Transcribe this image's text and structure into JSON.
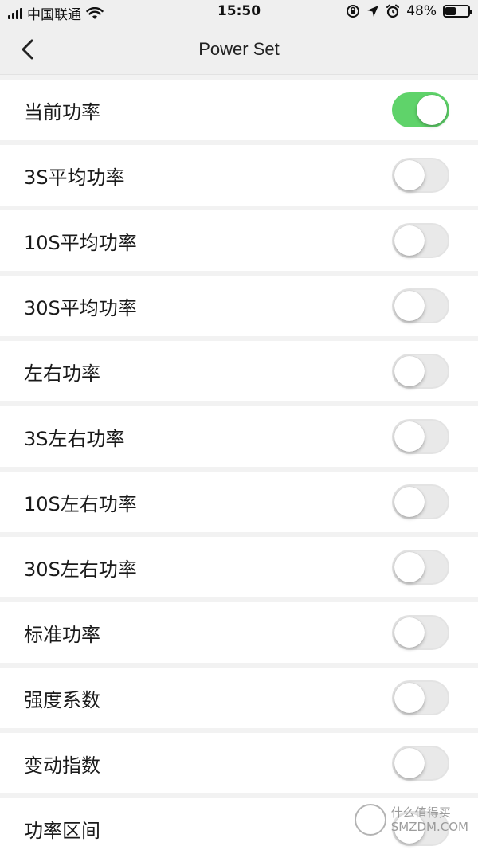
{
  "status_bar": {
    "carrier": "中国联通",
    "time": "15:50",
    "battery_percent_text": "48%",
    "battery_level": 0.48
  },
  "nav": {
    "title": "Power Set"
  },
  "colors": {
    "toggle_on": "#5fd36a",
    "toggle_off": "#e9e9e9",
    "background": "#f2f2f2"
  },
  "settings": [
    {
      "label": "当前功率",
      "enabled": true
    },
    {
      "label": "3S平均功率",
      "enabled": false
    },
    {
      "label": "10S平均功率",
      "enabled": false
    },
    {
      "label": "30S平均功率",
      "enabled": false
    },
    {
      "label": "左右功率",
      "enabled": false
    },
    {
      "label": "3S左右功率",
      "enabled": false
    },
    {
      "label": "10S左右功率",
      "enabled": false
    },
    {
      "label": "30S左右功率",
      "enabled": false
    },
    {
      "label": "标准功率",
      "enabled": false
    },
    {
      "label": "强度系数",
      "enabled": false
    },
    {
      "label": "变动指数",
      "enabled": false
    },
    {
      "label": "功率区间",
      "enabled": false
    }
  ],
  "watermark": {
    "line1": "什么值得买",
    "line2": "SMZDM.COM"
  }
}
